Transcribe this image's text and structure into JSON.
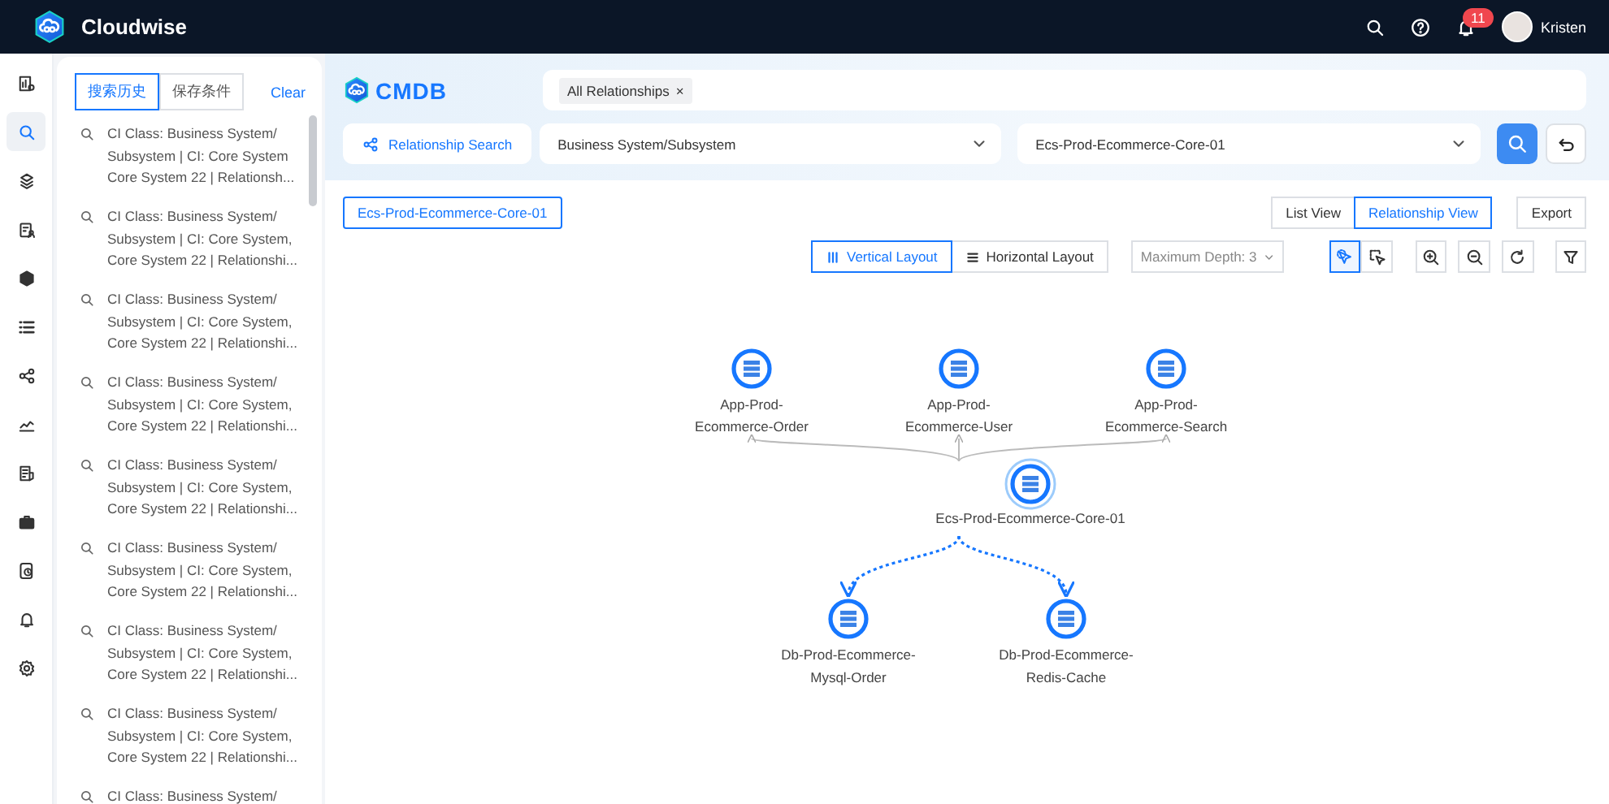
{
  "topbar": {
    "brand": "Cloudwise",
    "notifications": "11",
    "user": "Kristen"
  },
  "rail": [
    {
      "selected": false
    },
    {
      "selected": true
    },
    {
      "selected": false
    },
    {
      "selected": false
    },
    {
      "selected": false
    },
    {
      "selected": false
    },
    {
      "selected": false
    },
    {
      "selected": false
    },
    {
      "selected": false
    },
    {
      "selected": false
    },
    {
      "selected": false
    },
    {
      "selected": false
    },
    {
      "selected": false
    }
  ],
  "history": {
    "tabs": [
      {
        "label": "搜索历史",
        "selected": true
      },
      {
        "label": "保存条件",
        "selected": false
      }
    ],
    "clear": "Clear",
    "items": [
      {
        "lines": [
          "CI Class: Business System/",
          "Subsystem | CI: Core System",
          "Core System 22 | Relationsh..."
        ]
      },
      {
        "lines": [
          "CI Class: Business System/",
          "Subsystem | CI: Core System,",
          "Core System 22 | Relationshi..."
        ]
      },
      {
        "lines": [
          "CI Class: Business System/",
          "Subsystem | CI: Core System,",
          "Core System 22 | Relationshi..."
        ]
      },
      {
        "lines": [
          "CI Class: Business System/",
          "Subsystem | CI: Core System,",
          "Core System 22 | Relationshi..."
        ]
      },
      {
        "lines": [
          "CI Class: Business System/",
          "Subsystem | CI: Core System,",
          "Core System 22 | Relationshi..."
        ]
      },
      {
        "lines": [
          "CI Class: Business System/",
          "Subsystem | CI: Core System,",
          "Core System 22 | Relationshi..."
        ]
      },
      {
        "lines": [
          "CI Class: Business System/",
          "Subsystem | CI: Core System,",
          "Core System 22 | Relationshi..."
        ]
      },
      {
        "lines": [
          "CI Class: Business System/",
          "Subsystem | CI: Core System,",
          "Core System 22 | Relationshi..."
        ]
      },
      {
        "lines": [
          "CI Class: Business System/"
        ]
      }
    ]
  },
  "search": {
    "logo": "CMDB",
    "filter_tag": "All Relationships",
    "remove_symbol": "×",
    "mode_button": "Relationship Search",
    "ci_class": "Business System/Subsystem",
    "ci_instance": "Ecs-Prod-Ecommerce-Core-01"
  },
  "toolbar": {
    "current_ci": "Ecs-Prod-Ecommerce-Core-01",
    "views": [
      {
        "label": "List View",
        "selected": false
      },
      {
        "label": "Relationship View",
        "selected": true
      }
    ],
    "export": "Export",
    "layouts": [
      {
        "label": "Vertical Layout",
        "selected": true
      },
      {
        "label": "Horizontal Layout",
        "selected": false
      }
    ],
    "depth": "Maximum Depth: 3",
    "select_tools": [
      {
        "selected": true
      },
      {
        "selected": false
      }
    ]
  },
  "graph": {
    "center": "Ecs-Prod-Ecommerce-Core-01",
    "upstream": [
      [
        "App-Prod-",
        "Ecommerce-Order"
      ],
      [
        "App-Prod-",
        "Ecommerce-User"
      ],
      [
        "App-Prod-",
        "Ecommerce-Search"
      ]
    ],
    "downstream": [
      [
        "Db-Prod-Ecommerce-",
        "Mysql-Order"
      ],
      [
        "Db-Prod-Ecommerce-",
        "Redis-Cache"
      ]
    ]
  }
}
